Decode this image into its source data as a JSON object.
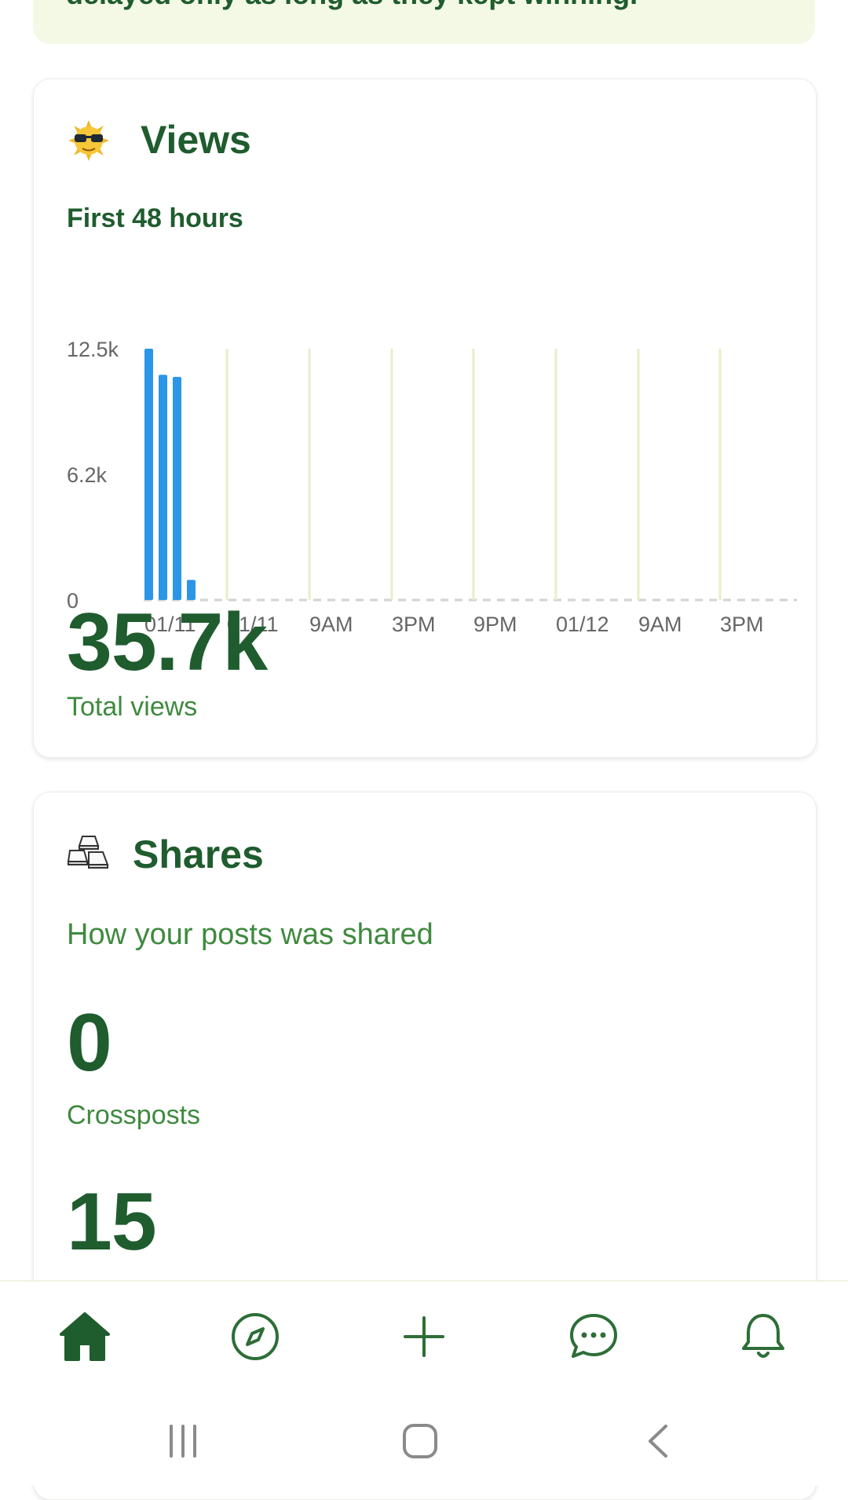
{
  "banner": {
    "text": "delayed only as long as they kept winning."
  },
  "views_card": {
    "title": "Views",
    "icon": "sunglasses-sun-icon",
    "subtitle": "First 48 hours",
    "total": "35.7k",
    "total_label": "Total views"
  },
  "chart_data": {
    "type": "bar",
    "y_ticks": [
      "12.5k",
      "6.2k",
      "0"
    ],
    "ylim": [
      0,
      12500
    ],
    "x_labels": [
      "01/11",
      "01/11",
      "9AM",
      "3PM",
      "9PM",
      "01/12",
      "9AM",
      "3PM"
    ],
    "values": [
      12500,
      11200,
      11100,
      1000
    ],
    "colors": {
      "bar": "#2b96e8",
      "grid": "#e6efc9",
      "baseline": "#cfd5cc"
    }
  },
  "shares_card": {
    "title": "Shares",
    "icon": "keycaps-icon",
    "subtitle": "How your posts was shared",
    "crossposts": "0",
    "crossposts_label": "Crossposts",
    "second_stat": "15"
  },
  "bottom_nav": {
    "items": [
      {
        "name": "home",
        "icon": "home-icon",
        "active": true
      },
      {
        "name": "explore",
        "icon": "compass-icon",
        "active": false
      },
      {
        "name": "create",
        "icon": "plus-icon",
        "active": false
      },
      {
        "name": "chat",
        "icon": "chat-bubble-icon",
        "active": false
      },
      {
        "name": "notifications",
        "icon": "bell-icon",
        "active": false
      }
    ]
  },
  "colors": {
    "primary": "#1f5c2e",
    "secondary": "#3f8a3f",
    "accent_bg": "#f4f9e6"
  }
}
